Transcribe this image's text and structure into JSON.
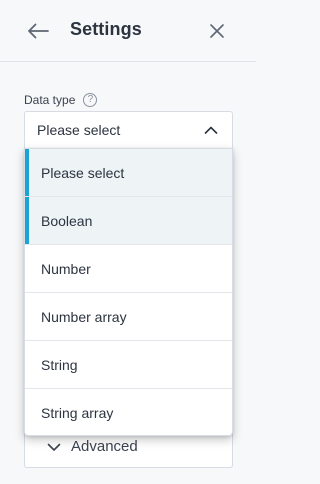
{
  "header": {
    "title": "Settings",
    "back_icon": "arrow-left-icon",
    "close_icon": "close-icon"
  },
  "field": {
    "label": "Data type",
    "help_icon": "question-circle-icon",
    "help_glyph": "?",
    "selected_value": "Please select",
    "chevron_icon": "chevron-up-icon"
  },
  "dropdown": {
    "options": [
      {
        "label": "Please select",
        "highlighted": true
      },
      {
        "label": "Boolean",
        "highlighted": true
      },
      {
        "label": "Number",
        "highlighted": false
      },
      {
        "label": "Number array",
        "highlighted": false
      },
      {
        "label": "String",
        "highlighted": false
      },
      {
        "label": "String array",
        "highlighted": false
      }
    ]
  },
  "advanced": {
    "label": "Advanced",
    "chevron_icon": "chevron-down-icon"
  },
  "colors": {
    "accent": "#1ba3d6",
    "background": "#f6f8fa",
    "highlight": "#eef3f6"
  }
}
